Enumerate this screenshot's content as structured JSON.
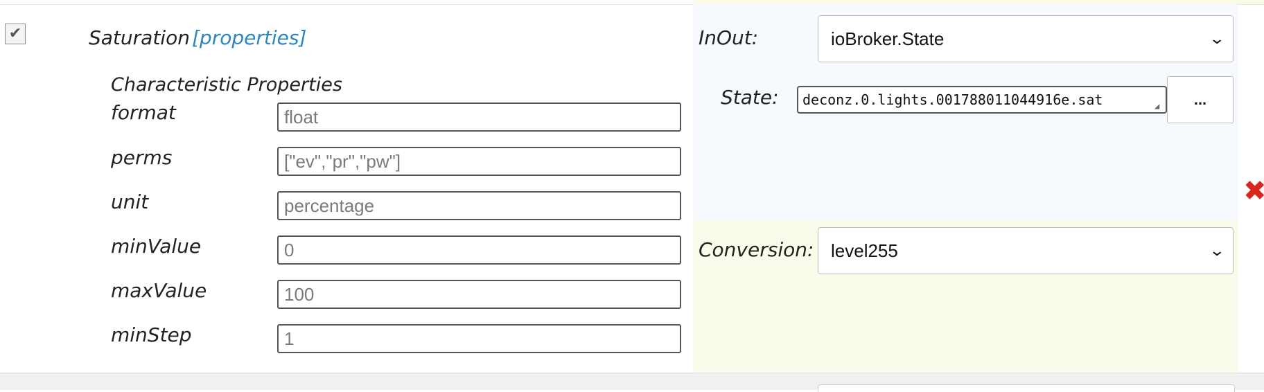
{
  "characteristic": {
    "checked": true,
    "checkbox_glyph": "✔",
    "title": "Saturation",
    "properties_link": "[properties]"
  },
  "properties": {
    "section_title": "Characteristic Properties",
    "rows": [
      {
        "label": "format",
        "value": "float"
      },
      {
        "label": "perms",
        "value": "[\"ev\",\"pr\",\"pw\"]"
      },
      {
        "label": "unit",
        "value": "percentage"
      },
      {
        "label": "minValue",
        "value": "0"
      },
      {
        "label": "maxValue",
        "value": "100"
      },
      {
        "label": "minStep",
        "value": "1"
      }
    ]
  },
  "inout": {
    "label": "InOut:",
    "selected": "ioBroker.State"
  },
  "state": {
    "label": "State:",
    "value": "deconz.0.lights.001788011044916e.sat",
    "browse_label": "..."
  },
  "conversion": {
    "label": "Conversion:",
    "selected": "level255"
  },
  "icons": {
    "dropdown": "chevron-down-icon",
    "delete": "close-icon",
    "resize": "resize-grip-icon"
  },
  "colors": {
    "link": "#2a86c3",
    "delete": "#d9261c",
    "panel_blue": "#f6f9fd",
    "panel_yellow": "#fbfbeb"
  }
}
